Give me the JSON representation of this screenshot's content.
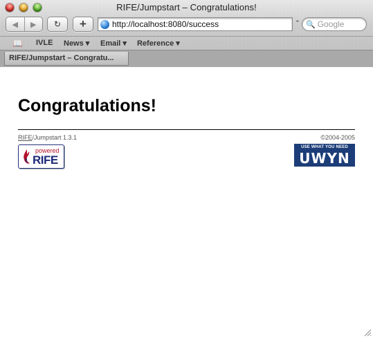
{
  "window": {
    "title": "RIFE/Jumpstart – Congratulations!"
  },
  "toolbar": {
    "back_glyph": "◀",
    "forward_glyph": "▶",
    "reload_glyph": "↻",
    "add_bookmark_glyph": "+",
    "url": "http://localhost:8080/success",
    "url_menu_glyph": "⌃",
    "search_placeholder": "Google",
    "search_glyph": "🔍"
  },
  "bookmarks": {
    "book_glyph": "📖",
    "items": [
      {
        "label": "IVLE"
      },
      {
        "label": "News ▾"
      },
      {
        "label": "Email ▾"
      },
      {
        "label": "Reference ▾"
      }
    ]
  },
  "tabs": [
    {
      "label": "RIFE/Jumpstart – Congratu..."
    }
  ],
  "page": {
    "heading": "Congratulations!",
    "footer": {
      "product_link": "RIFE",
      "product_rest": "/Jumpstart 1.3.1",
      "copyright": "©2004-2005"
    },
    "badges": {
      "rife_small": "powered",
      "rife_name": "RIFE",
      "uwyn_tagline": "USE WHAT YOU NEED",
      "uwyn_word": "UWYN"
    }
  },
  "colors": {
    "rife_blue": "#1d2a7a",
    "rife_red": "#b3122a",
    "uwyn_bg": "#1c3d78"
  }
}
